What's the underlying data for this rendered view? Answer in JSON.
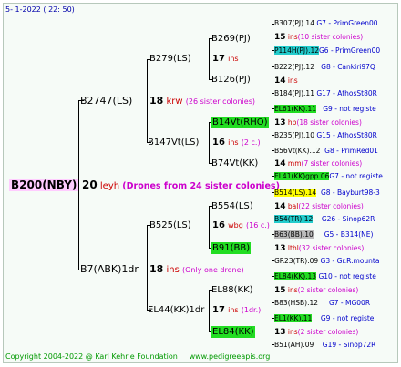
{
  "header": {
    "date_line": "5-   1-2022 ( 22:  50)"
  },
  "footer": {
    "copyright": "Copyright 2004-2022 @ Karl Kehrle Foundation",
    "site": "www.pedigreeapis.org"
  },
  "root": {
    "name": "B200(NBY)",
    "age": "20",
    "unit": "ley",
    "mark": "h",
    "note": "(Drones from 24 sister colonies)"
  },
  "gen1": [
    {
      "name": "B2747(LS)",
      "age": "18",
      "unit": "krw",
      "note": "(26 sister colonies)"
    },
    {
      "name": "B7(ABK)1dr",
      "age": "18",
      "unit": "ins",
      "note": "(Only one drone)"
    }
  ],
  "gen2": [
    {
      "name": "B279(LS)",
      "age": "17",
      "unit": "ins",
      "note": ""
    },
    {
      "name": "B147Vt(LS)",
      "age": "16",
      "unit": "ins",
      "note": "(2 c.)"
    },
    {
      "name": "B525(LS)",
      "age": "16",
      "unit": "wbg",
      "note": "(16 c.)"
    },
    {
      "name": "EL44(KK)1dr",
      "age": "17",
      "unit": "ins",
      "note": "(1dr.)"
    }
  ],
  "gen3": [
    {
      "name": "B269(PJ)"
    },
    {
      "name": "B126(PJ)"
    },
    {
      "name": "B14Vt(RHO)"
    },
    {
      "name": "B74Vt(KK)"
    },
    {
      "name": "B554(LS)"
    },
    {
      "name": "B91(BB)"
    },
    {
      "name": "EL88(KK)"
    },
    {
      "name": "EL84(KK)"
    }
  ],
  "gen4": [
    {
      "name": "B307(PJ).14",
      "ref": "G7 - PrimGreen00"
    },
    {
      "age": "15",
      "unit": "ins",
      "note": "(10 sister colonies)"
    },
    {
      "name": "P114H(PJ).12",
      "ref": "G6 - PrimGreen00"
    },
    {
      "name": "B222(PJ).12",
      "ref": "G8 - Cankiri97Q"
    },
    {
      "age": "14",
      "unit": "ins",
      "note": ""
    },
    {
      "name": "B184(PJ).11",
      "ref": "G17 - AthosSt80R"
    },
    {
      "name": "EL61(KK).11",
      "ref": "G9 - not registe"
    },
    {
      "age": "13",
      "unit": "hb",
      "note": "(18 sister colonies)"
    },
    {
      "name": "B235(PJ).10",
      "ref": "G15 - AthosSt80R"
    },
    {
      "name": "B56Vt(KK).12",
      "ref": "G8 - PrimRed01"
    },
    {
      "age": "14",
      "unit": "mm",
      "note": "(7 sister colonies)"
    },
    {
      "name": "EL41(KK)gpp.06",
      "ref": "G7 - not registe"
    },
    {
      "name": "B514(LS).14",
      "ref": "G8 - Bayburt98-3"
    },
    {
      "age": "14",
      "unit": "bal",
      "note": "(22 sister colonies)"
    },
    {
      "name": "B54(TR).12",
      "ref": "G26 - Sinop62R"
    },
    {
      "name": "B63(BB).10",
      "ref": "G5 - B314(NE)"
    },
    {
      "age": "13",
      "unit": "lthl",
      "note": "(32 sister colonies)"
    },
    {
      "name": "GR23(TR).09",
      "ref": "G3 - Gr.R.mounta"
    },
    {
      "name": "EL84(KK).13",
      "ref": "G10 - not registe"
    },
    {
      "age": "15",
      "unit": "ins",
      "note": "(2 sister colonies)"
    },
    {
      "name": "B83(HSB).12",
      "ref": "G7 - MG00R"
    },
    {
      "name": "EL1(KK).11",
      "ref": "G9 - not registe"
    },
    {
      "age": "13",
      "unit": "ins",
      "note": "(2 sister colonies)"
    },
    {
      "name": "B51(AH).09",
      "ref": "G19 - Sinop72R"
    }
  ],
  "colors": {
    "green_box": "#22dd22",
    "cyan_box": "#22cccc",
    "yellow_box": "#ffff00",
    "gray_box": "#bbbbbb",
    "root_box": "#ffccff"
  }
}
